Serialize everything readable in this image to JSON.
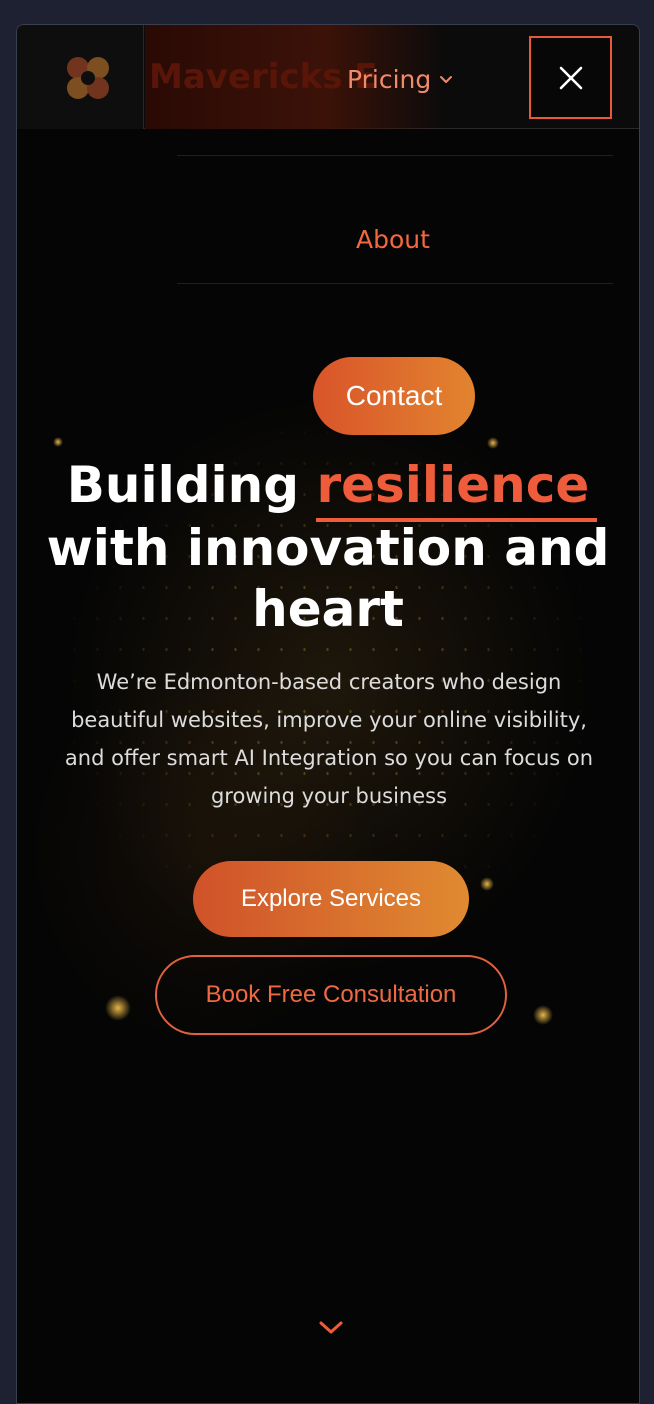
{
  "header": {
    "brand": "Mavericks E",
    "logo_icon": "mavericks-logo-icon",
    "close_icon": "close-icon"
  },
  "nav": {
    "pricing": "Pricing",
    "pricing_icon": "chevron-down-icon",
    "about": "About",
    "contact": "Contact"
  },
  "hero": {
    "title_prefix": "Building ",
    "title_accent": "resilience",
    "title_line2": "with innovation and",
    "title_line3": "heart",
    "subtitle": "We’re Edmonton-based creators who design beautiful websites, improve your online visibility, and offer smart AI Integration so you can focus on growing your business",
    "primary_cta": "Explore Services",
    "secondary_cta": "Book Free Consultation",
    "scroll_icon": "chevron-down-icon"
  },
  "colors": {
    "accent": "#ee5c3b",
    "gradient_start": "#d0522a",
    "gradient_end": "#e08a31",
    "background": "#050505",
    "page_background": "#1d2132"
  }
}
